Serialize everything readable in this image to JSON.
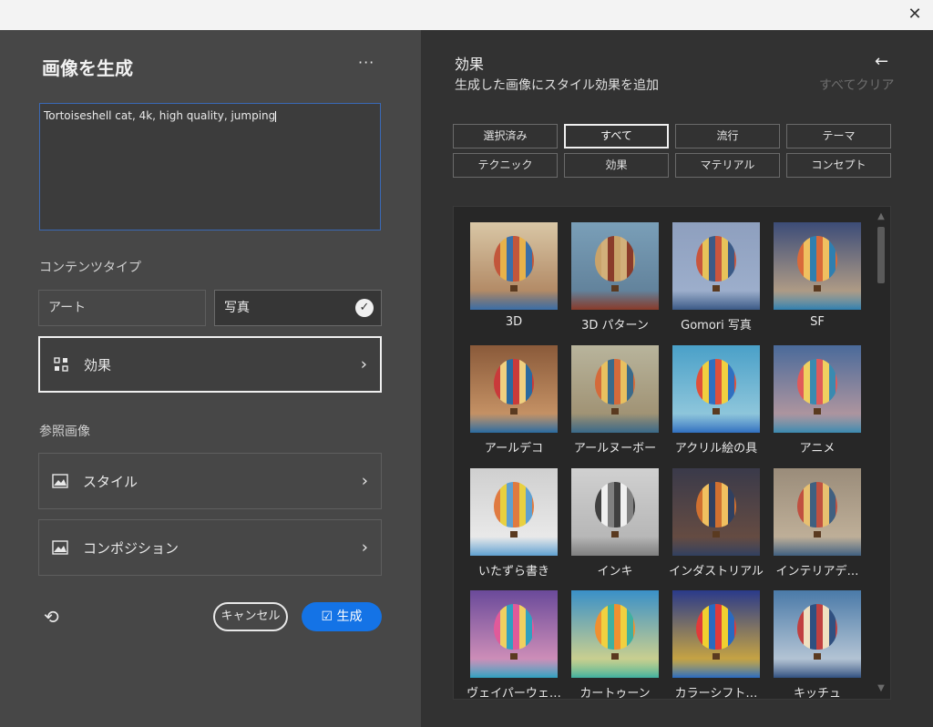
{
  "window": {
    "close_icon": "close-icon"
  },
  "left": {
    "title": "画像を生成",
    "more": "···",
    "prompt": "Tortoiseshell cat, 4k, high quality, jumping",
    "content_type_label": "コンテンツタイプ",
    "content_types": [
      {
        "label": "アート",
        "selected": false
      },
      {
        "label": "写真",
        "selected": true
      }
    ],
    "effects_button": "効果",
    "reference_label": "参照画像",
    "style_button": "スタイル",
    "composition_button": "コンポジション",
    "cancel": "キャンセル",
    "generate": "生成"
  },
  "right": {
    "title": "効果",
    "subtitle": "生成した画像にスタイル効果を追加",
    "clear_all": "すべてクリア",
    "filters": [
      "選択済み",
      "すべて",
      "流行",
      "テーマ",
      "テクニック",
      "効果",
      "マテリアル",
      "コンセプト"
    ],
    "selected_filter": "すべて",
    "tiles": [
      {
        "label": "3D"
      },
      {
        "label": "3D パターン"
      },
      {
        "label": "Gomori 写真"
      },
      {
        "label": "SF"
      },
      {
        "label": "アールデコ"
      },
      {
        "label": "アールヌーボー"
      },
      {
        "label": "アクリル絵の具"
      },
      {
        "label": "アニメ"
      },
      {
        "label": "いたずら書き"
      },
      {
        "label": "インキ"
      },
      {
        "label": "インダストリアル"
      },
      {
        "label": "インテリアデ…"
      },
      {
        "label": "ヴェイパーウェ…"
      },
      {
        "label": "カートゥーン"
      },
      {
        "label": "カラーシフト…"
      },
      {
        "label": "キッチュ"
      }
    ]
  },
  "colors": {
    "accent": "#1473e6",
    "left_bg": "#474747",
    "right_bg": "#323232"
  }
}
